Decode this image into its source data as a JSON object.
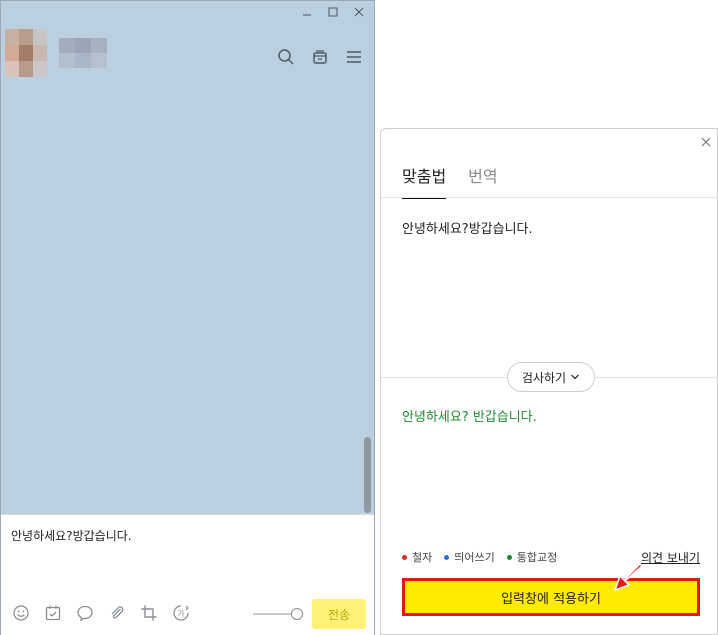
{
  "chat": {
    "input_text": "안녕하세요?방갑습니다.",
    "send_label": "전송"
  },
  "panel": {
    "tabs": [
      "맞춤법",
      "번역"
    ],
    "source_text": "안녕하세요?방갑습니다.",
    "check_label": "검사하기",
    "result_text": "안녕하세요? 반갑습니다.",
    "legend": [
      {
        "label": "철자",
        "color": "#e32626"
      },
      {
        "label": "띄어쓰기",
        "color": "#2a6ee6"
      },
      {
        "label": "통합교정",
        "color": "#1e8a32"
      }
    ],
    "feedback_label": "의견 보내기",
    "apply_label": "입력창에 적용하기"
  },
  "colors": {
    "chat_bg": "#bacfe0",
    "send_bg": "#fdf178",
    "apply_bg": "#ffeb00",
    "highlight": "#e31818"
  }
}
